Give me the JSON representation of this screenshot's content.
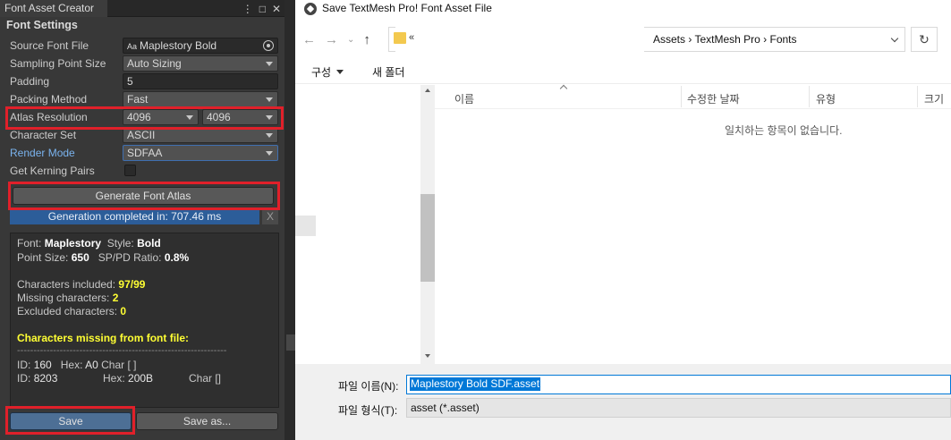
{
  "unity": {
    "tab_title": "Font Asset Creator",
    "section_title": "Font Settings",
    "fields": {
      "source_font_file": {
        "label": "Source Font File",
        "value": "Maplestory Bold",
        "prefix": "Aa"
      },
      "sampling_point_size": {
        "label": "Sampling Point Size",
        "value": "Auto Sizing"
      },
      "padding": {
        "label": "Padding",
        "value": "5"
      },
      "packing_method": {
        "label": "Packing Method",
        "value": "Fast"
      },
      "atlas_resolution": {
        "label": "Atlas Resolution",
        "width": "4096",
        "height": "4096"
      },
      "character_set": {
        "label": "Character Set",
        "value": "ASCII"
      },
      "render_mode": {
        "label": "Render Mode",
        "value": "SDFAA"
      },
      "get_kerning_pairs": {
        "label": "Get Kerning Pairs",
        "checked": false
      }
    },
    "generate_button": "Generate Font Atlas",
    "progress": {
      "text": "Generation completed in: 707.46 ms",
      "fraction": 1.0,
      "close": "X"
    },
    "info": {
      "font_label": "Font:",
      "font_value": "Maplestory",
      "style_label": "Style:",
      "style_value": "Bold",
      "point_size_label": "Point Size:",
      "point_size_value": "650",
      "ratio_label": "SP/PD Ratio:",
      "ratio_value": "0.8%",
      "included_label": "Characters included:",
      "included_value": "97/99",
      "missing_label": "Missing characters:",
      "missing_value": "2",
      "excluded_label": "Excluded characters:",
      "excluded_value": "0",
      "missing_header": "Characters missing from font file:",
      "separator": "----------------------------------------------------------------",
      "rows": [
        {
          "id_label": "ID:",
          "id": "160",
          "hex_label": "Hex:",
          "hex": "A0",
          "char": "Char [ ]"
        },
        {
          "id_label": "ID:",
          "id": "8203",
          "hex_label": "Hex:",
          "hex": "200B",
          "char": "Char []"
        }
      ]
    },
    "save_button": "Save",
    "save_as_button": "Save as..."
  },
  "dialog": {
    "title": "Save TextMesh Pro! Font Asset File",
    "address_prefix": "«",
    "breadcrumb": [
      "Assets",
      "TextMesh Pro",
      "Fonts"
    ],
    "breadcrumb_text": "Assets  ›  TextMesh Pro  ›  Fonts",
    "toolbar": {
      "organize": "구성",
      "new_folder": "새 폴더"
    },
    "columns": [
      "이름",
      "수정한 날짜",
      "유형",
      "크기"
    ],
    "empty_message": "일치하는 항목이 없습니다.",
    "file_name_label": "파일 이름(N):",
    "file_name_value": "Maplestory Bold SDF.asset",
    "file_type_label": "파일 형식(T):",
    "file_type_value": "asset (*.asset)"
  },
  "colors": {
    "highlight_box": "#e0202a",
    "progress_fill": "#2c5d99",
    "selection": "#0078d7"
  }
}
